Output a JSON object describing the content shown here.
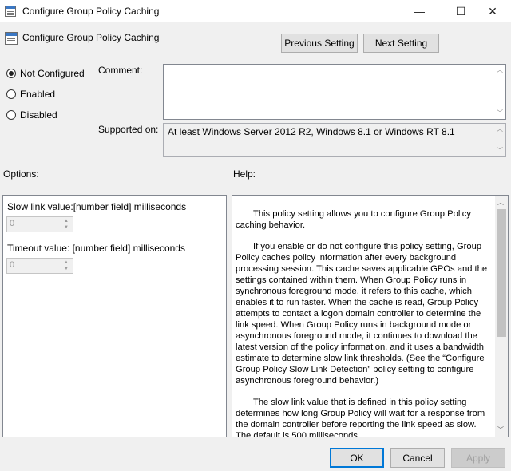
{
  "window": {
    "title": "Configure Group Policy Caching",
    "minimize_glyph": "—",
    "maximize_glyph": "☐",
    "close_glyph": "✕"
  },
  "header": {
    "title": "Configure Group Policy Caching",
    "prev_label": "Previous Setting",
    "next_label": "Next Setting"
  },
  "state": {
    "options": [
      {
        "label": "Not Configured",
        "checked": true
      },
      {
        "label": "Enabled",
        "checked": false
      },
      {
        "label": "Disabled",
        "checked": false
      }
    ]
  },
  "comment": {
    "label": "Comment:",
    "value": ""
  },
  "supported": {
    "label": "Supported on:",
    "value": "At least Windows Server 2012 R2, Windows 8.1 or Windows RT 8.1"
  },
  "options_panel": {
    "label": "Options:",
    "slow_link_label": "Slow link value:[number field] milliseconds",
    "slow_link_value": "0",
    "timeout_label": "Timeout value: [number field] milliseconds",
    "timeout_value": "0"
  },
  "help_panel": {
    "label": "Help:",
    "p1": "This policy setting allows you to configure Group Policy caching behavior.",
    "p2": "If you enable or do not configure this policy setting, Group Policy caches policy information after every background processing session. This cache saves applicable GPOs and the settings contained within them. When Group Policy runs in synchronous foreground mode, it refers to this cache, which enables it to run faster. When the cache is read, Group Policy attempts to contact a logon domain controller to determine the link speed. When Group Policy runs in background mode or asynchronous foreground mode, it continues to download the latest version of the policy information, and it uses a bandwidth estimate to determine slow link thresholds. (See the “Configure Group Policy Slow Link Detection” policy setting to configure asynchronous foreground behavior.)",
    "p3": "The slow link value that is defined in this policy setting determines how long Group Policy will wait for a response from the domain controller before reporting the link speed as slow. The default is 500 milliseconds."
  },
  "footer": {
    "ok_label": "OK",
    "cancel_label": "Cancel",
    "apply_label": "Apply"
  },
  "colors": {
    "accent": "#0078d7",
    "window_bg": "#f0f0f0"
  }
}
